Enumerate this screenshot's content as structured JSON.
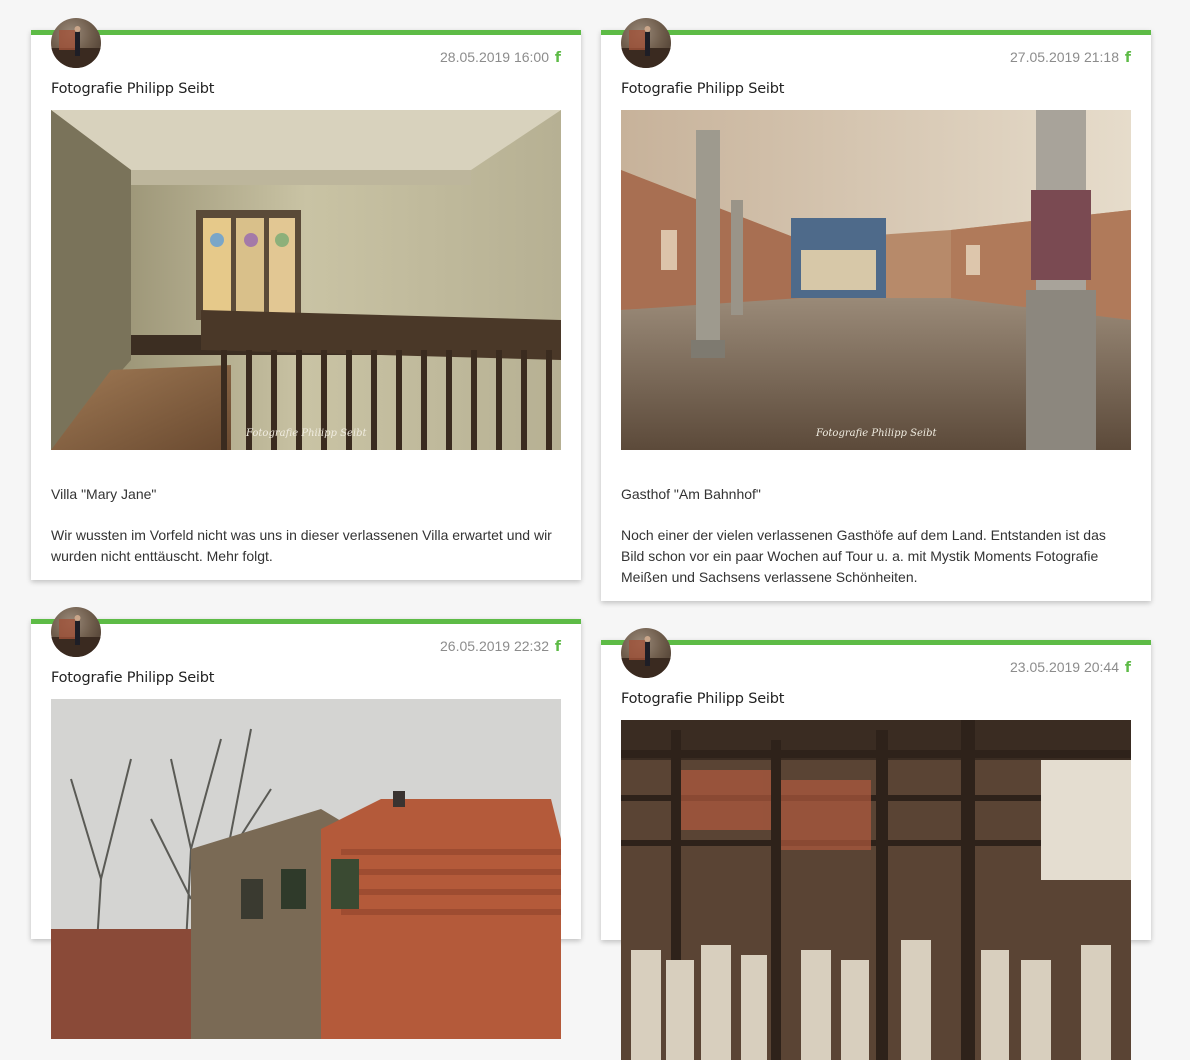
{
  "posts": [
    {
      "date": "28.05.2019 16:00",
      "author": "Fotografie Philipp Seibt",
      "image_watermark": "Fotografie Philipp Seibt",
      "title": "Villa \"Mary Jane\"",
      "text": "Wir wussten im Vorfeld nicht was uns in dieser verlassenen Villa erwartet und wir wurden nicht enttäuscht. Mehr folgt."
    },
    {
      "date": "27.05.2019 21:18",
      "author": "Fotografie Philipp Seibt",
      "image_watermark": "Fotografie Philipp Seibt",
      "title": "Gasthof \"Am Bahnhof\"",
      "text": "Noch einer der vielen verlassenen Gasthöfe auf dem Land. Entstanden ist das Bild schon vor ein paar Wochen auf Tour u. a. mit Mystik Moments Fotografie Meißen und Sachsens verlassene Schönheiten."
    },
    {
      "date": "26.05.2019 22:32",
      "author": "Fotografie Philipp Seibt"
    },
    {
      "date": "23.05.2019 20:44",
      "author": "Fotografie Philipp Seibt"
    }
  ],
  "icons": {
    "share": "facebook-icon",
    "fb_glyph": "f"
  },
  "colors": {
    "accent": "#5dbb46",
    "date": "#8c8c8c",
    "background": "#f6f6f6"
  }
}
